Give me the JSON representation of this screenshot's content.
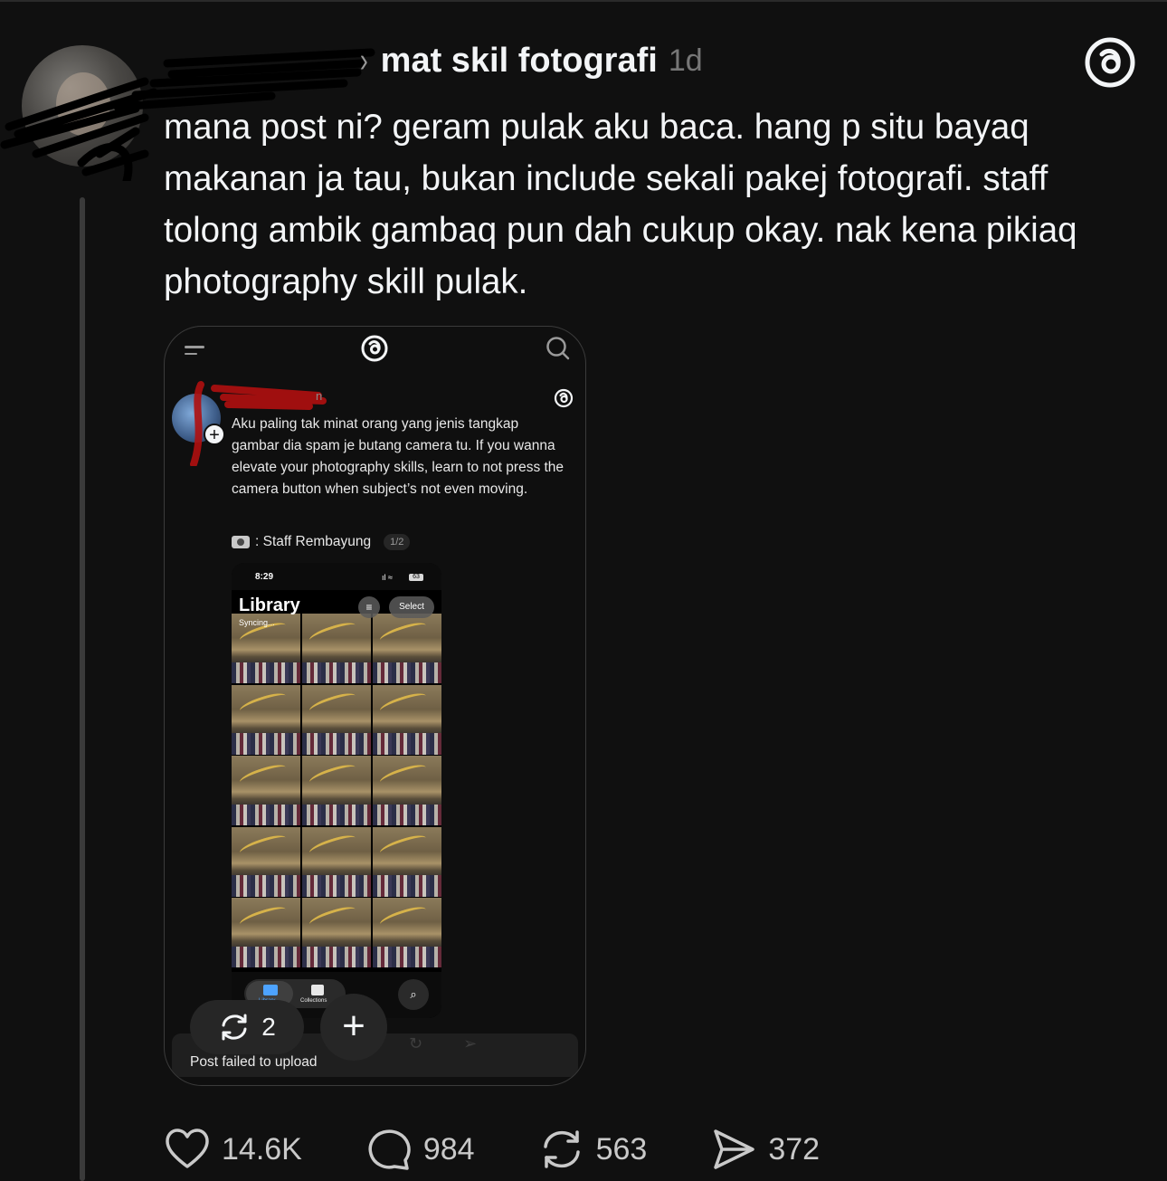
{
  "post": {
    "forum": "mat skil fotografi",
    "time": "1d",
    "chevron": "›",
    "text": "mana post ni? geram pulak aku baca. hang p situ bayaq makanan ja tau, bukan include sekali pakej fotografi. staff tolong ambik gambaq pun dah cukup okay. nak kena pikiaq photography skill pulak."
  },
  "embedded": {
    "author_fragment": "n",
    "text": "Aku paling tak minat orang yang jenis tangkap gambar dia spam je butang camera tu. If you wanna elevate your photography skills, learn to not press the camera button when subject’s not even moving.",
    "caption": ": Staff Rembayung",
    "page_badge": "1/2",
    "phone": {
      "time": "8:29",
      "battery": "63",
      "library_title": "Library",
      "syncing": "Syncing...",
      "select_label": "Select",
      "tab_library": "Library",
      "tab_collections": "Collections"
    },
    "retry_count": "2",
    "fail_text": "Post failed to upload"
  },
  "actions": {
    "likes": "14.6K",
    "replies": "984",
    "reposts": "563",
    "shares": "372"
  },
  "colors": {
    "background": "#101010",
    "text": "#f3f5f7",
    "muted": "#777777"
  },
  "icons": [
    "threads-logo-icon",
    "heart-icon",
    "comment-icon",
    "repost-icon",
    "share-icon",
    "menu-icon",
    "search-icon",
    "plus-icon"
  ]
}
